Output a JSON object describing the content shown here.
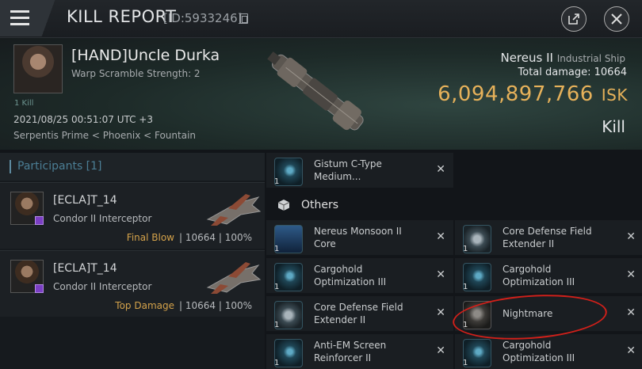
{
  "header": {
    "title": "KILL REPORT",
    "id": "[ID:5933246]"
  },
  "victim": {
    "name": "[HAND]Uncle Durka",
    "subtitle": "Warp Scramble Strength: 2",
    "kill_count": "1 Kill",
    "time": "2021/08/25 00:51:07 UTC +3",
    "location": "Serpentis Prime < Phoenix < Fountain"
  },
  "ship": {
    "name": "Nereus II",
    "class": "Industrial Ship",
    "total_damage_label": "Total damage:",
    "total_damage": "10664",
    "isk_value": "6,094,897,766",
    "isk_unit": "ISK",
    "result": "Kill"
  },
  "participants": {
    "header": "Participants [1]",
    "rows": [
      {
        "name": "[ECLA]T_14",
        "ship": "Condor II Interceptor",
        "role": "Final Blow",
        "stats": "| 10664 | 100%"
      },
      {
        "name": "[ECLA]T_14",
        "ship": "Condor II Interceptor",
        "role": "Top Damage",
        "stats": "| 10664 | 100%"
      }
    ]
  },
  "items": {
    "top_item": {
      "qty": "1",
      "name": "Gistum C-Type Medium..."
    },
    "others_label": "Others",
    "list": [
      {
        "qty": "1",
        "name": "Nereus Monsoon II Core",
        "icon": "monsoon-core-icon"
      },
      {
        "qty": "1",
        "name": "Core Defense Field Extender II",
        "icon": "shield-rig-icon"
      },
      {
        "qty": "1",
        "name": "Cargohold Optimization III",
        "icon": "cargo-rig-icon"
      },
      {
        "qty": "1",
        "name": "Cargohold Optimization III",
        "icon": "cargo-rig-icon"
      },
      {
        "qty": "1",
        "name": "Core Defense Field Extender II",
        "icon": "shield-rig-icon"
      },
      {
        "qty": "1",
        "name": "Nightmare",
        "icon": "nightmare-icon"
      },
      {
        "qty": "1",
        "name": "Anti-EM Screen Reinforcer II",
        "icon": "em-rig-icon"
      },
      {
        "qty": "1",
        "name": "Cargohold Optimization III",
        "icon": "cargo-rig-icon"
      }
    ]
  },
  "colors": {
    "isk": "#e6b15a",
    "role": "#d4a24a",
    "annotation": "#d0201a"
  }
}
